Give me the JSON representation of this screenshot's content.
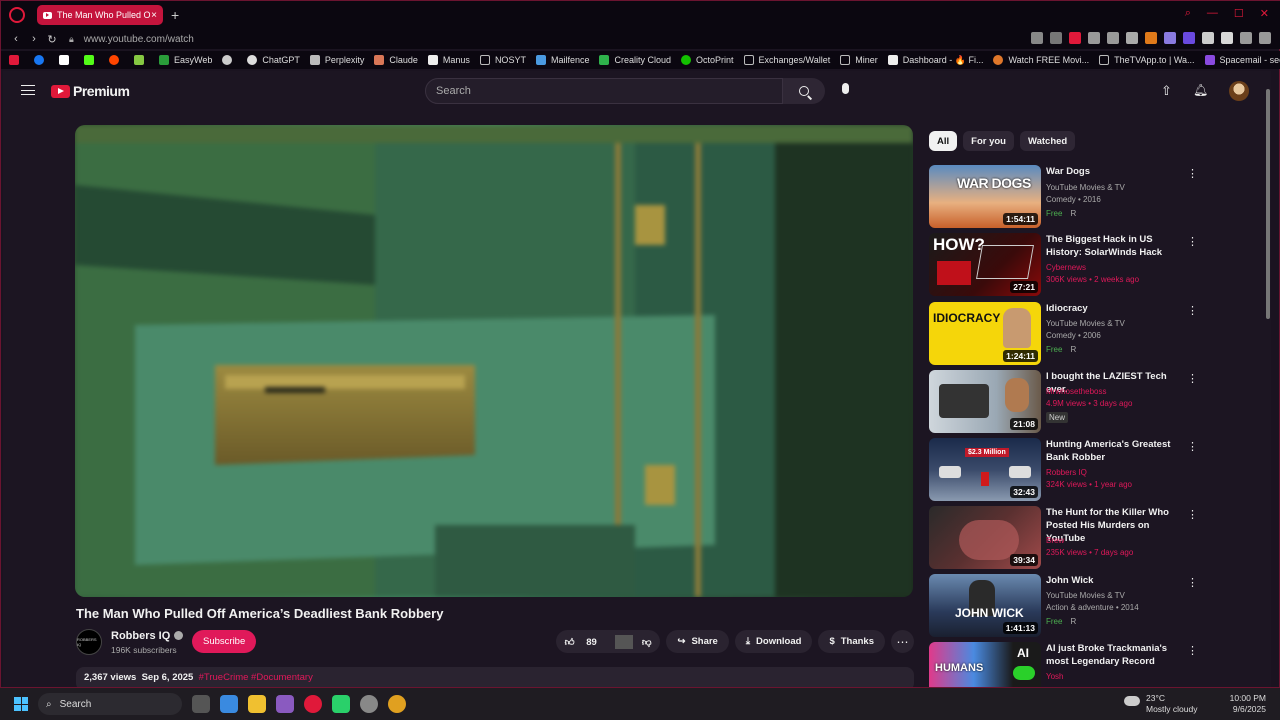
{
  "browser": {
    "tab_title": "The Man Who Pulled O",
    "url": "www.youtube.com/watch",
    "bookmarks": [
      "EasyWeb",
      "ChatGPT",
      "Perplexity",
      "Claude",
      "Manus",
      "NOSYT",
      "Mailfence",
      "Creality Cloud",
      "OctoPrint",
      "Exchanges/Wallet",
      "Miner",
      "Dashboard - 🔥 Fi...",
      "Watch FREE Movi...",
      "TheTVApp.to | Wa...",
      "Spacemail - secur..."
    ]
  },
  "masthead": {
    "logo_text": "Premium",
    "search_placeholder": "Search"
  },
  "video": {
    "title": "The Man Who Pulled Off America’s Deadliest Bank Robbery",
    "channel": "Robbers IQ",
    "channel_avatar_text": "ROBBERS IQ",
    "subscribers": "196K subscribers",
    "subscribe_label": "Subscribe",
    "likes": "89",
    "share_label": "Share",
    "download_label": "Download",
    "thanks_label": "Thanks",
    "views": "2,367 views",
    "date": "Sep 6, 2025",
    "tags": "#TrueCrime #Documentary"
  },
  "chips": [
    "All",
    "For you",
    "Watched"
  ],
  "recommendations": [
    {
      "title": "War Dogs",
      "line1": "YouTube Movies & TV",
      "line2": "Comedy • 2016",
      "badge": "Free",
      "rating": "R",
      "duration": "1:54:11",
      "thumb_text": "WAR DOGS"
    },
    {
      "title": "The Biggest Hack in US History: SolarWinds Hack",
      "channel": "Cybernews",
      "stats": "306K views • 2 weeks ago",
      "duration": "27:21",
      "thumb_text": "HOW?"
    },
    {
      "title": "Idiocracy",
      "line1": "YouTube Movies & TV",
      "line2": "Comedy • 2006",
      "badge": "Free",
      "rating": "R",
      "duration": "1:24:11",
      "thumb_text": "IDIOCRACY"
    },
    {
      "title": "I bought the LAZIEST Tech ever.",
      "channel": "Mrwhosetheboss",
      "stats": "4.9M views • 3 days ago",
      "new_badge": "New",
      "duration": "21:08"
    },
    {
      "title": "Hunting America's Greatest Bank Robber",
      "channel": "Robbers IQ",
      "stats": "324K views • 1 year ago",
      "duration": "32:43",
      "thumb_text": "$2.3 Million"
    },
    {
      "title": "The Hunt for the Killer Who Posted His Murders on YouTube",
      "channel": "Brew",
      "stats": "235K views • 7 days ago",
      "duration": "39:34"
    },
    {
      "title": "John Wick",
      "line1": "YouTube Movies & TV",
      "line2": "Action & adventure • 2014",
      "badge": "Free",
      "rating": "R",
      "duration": "1:41:13",
      "thumb_text": "JOHN WICK"
    },
    {
      "title": "AI just Broke Trackmania's most Legendary Record",
      "channel": "Yosh",
      "thumb_text": "AI"
    }
  ],
  "taskbar": {
    "search_label": "Search",
    "temperature": "23°C",
    "weather": "Mostly cloudy",
    "time": "10:00 PM",
    "date": "9/6/2025"
  },
  "colors": {
    "accent": "#e0195a",
    "brand_red": "#e0193a",
    "free_green": "#4caf50"
  }
}
